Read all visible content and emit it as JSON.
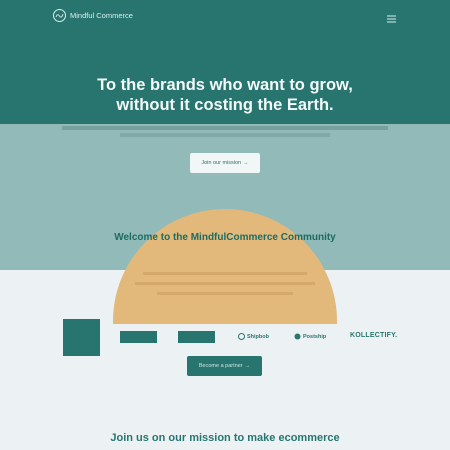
{
  "header": {
    "brand_name": "Mindful Commerce",
    "logo_icon": "leaf-wave-icon",
    "menu_icon": "hamburger-menu-icon"
  },
  "hero": {
    "title_line1": "To the brands who want to grow,",
    "title_line2": "without it costing the Earth.",
    "cta_label": "Join our mission",
    "cta_arrow": "→"
  },
  "community": {
    "title": "Welcome to the MindfulCommerce Community"
  },
  "partners": {
    "logos": [
      {
        "name": "partner-logo-1",
        "label": ""
      },
      {
        "name": "partner-logo-2",
        "label": ""
      },
      {
        "name": "partner-logo-3",
        "label": ""
      },
      {
        "name": "shipbob-logo",
        "label": "Shipbob"
      },
      {
        "name": "postship-logo",
        "label": "Postship"
      },
      {
        "name": "kollectify-logo",
        "label": "KOLLECTIFY."
      }
    ],
    "cta_label": "Become a partner",
    "cta_arrow": "→"
  },
  "mission": {
    "title_line1": "Join us on our mission to make ecommerce"
  },
  "colors": {
    "primary": "#28756f",
    "mid_band": "#92bab8",
    "light_bg": "#ecf2f3",
    "dome": "#e2b97a"
  }
}
